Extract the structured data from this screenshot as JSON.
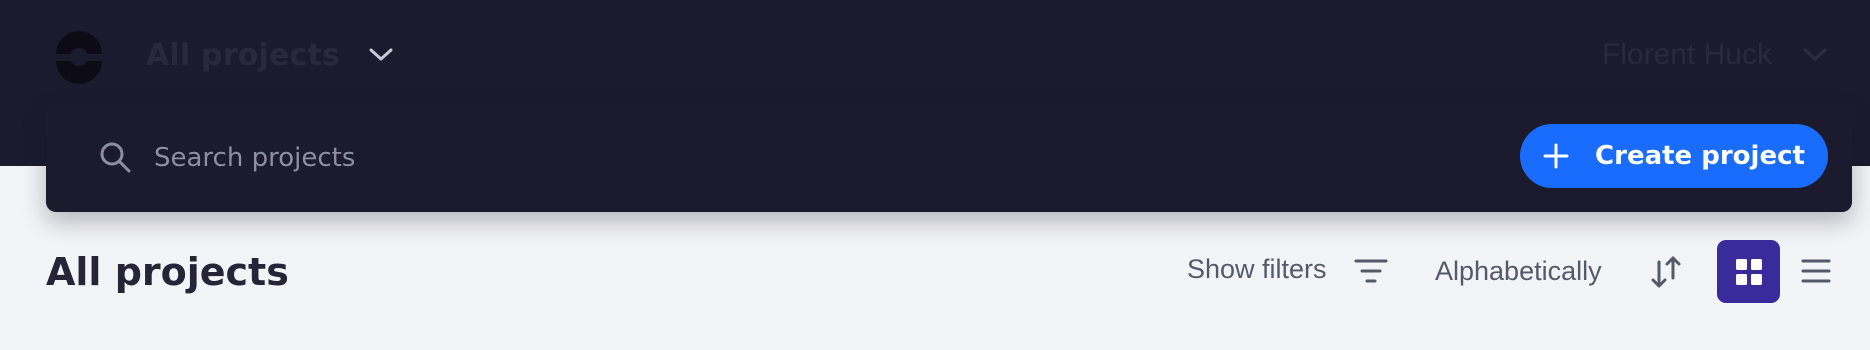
{
  "header": {
    "project_switcher_label": "All projects",
    "user_name": "Florent Huck"
  },
  "search": {
    "placeholder": "Search projects",
    "value": ""
  },
  "actions": {
    "create_project_label": "Create project"
  },
  "main": {
    "title": "All projects",
    "filters_label": "Show filters",
    "sort_label": "Alphabetically"
  },
  "colors": {
    "header_bg": "#1c1b2e",
    "accent_blue": "#1a6cff",
    "view_toggle_active": "#3a2b9b",
    "page_bg": "#f3f4f7"
  },
  "icons": {
    "logo": "app-logo",
    "search": "search-icon",
    "create": "plus-icon",
    "filters": "filter-icon",
    "sort": "sort-arrows-icon",
    "grid_view": "grid-view-icon",
    "list_view": "list-view-icon"
  }
}
